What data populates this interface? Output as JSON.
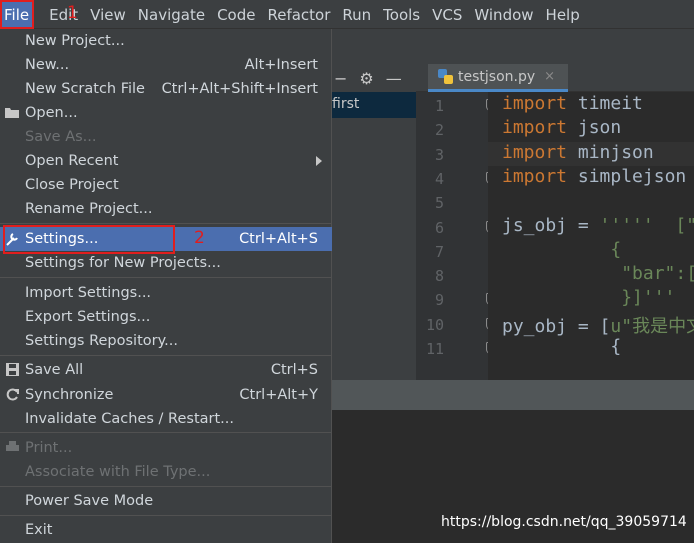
{
  "menubar": {
    "items": [
      "File",
      "Edit",
      "View",
      "Navigate",
      "Code",
      "Refactor",
      "Run",
      "Tools",
      "VCS",
      "Window",
      "Help"
    ]
  },
  "annotations": {
    "step1": "1",
    "step2": "2"
  },
  "file_menu": {
    "new_project": "New Project...",
    "new": "New...",
    "new_shortcut": "Alt+Insert",
    "new_scratch": "New Scratch File",
    "new_scratch_shortcut": "Ctrl+Alt+Shift+Insert",
    "open": "Open...",
    "save_as": "Save As...",
    "open_recent": "Open Recent",
    "close_project": "Close Project",
    "rename_project": "Rename Project...",
    "settings": "Settings...",
    "settings_shortcut": "Ctrl+Alt+S",
    "settings_new_projects": "Settings for New Projects...",
    "import_settings": "Import Settings...",
    "export_settings": "Export Settings...",
    "settings_repository": "Settings Repository...",
    "save_all": "Save All",
    "save_all_shortcut": "Ctrl+S",
    "synchronize": "Synchronize",
    "synchronize_shortcut": "Ctrl+Alt+Y",
    "invalidate_caches": "Invalidate Caches / Restart...",
    "print": "Print...",
    "associate": "Associate with File Type...",
    "power_save": "Power Save Mode",
    "exit": "Exit"
  },
  "project_panel": {
    "selected_item": "first"
  },
  "editor": {
    "tab_name": "testjson.py",
    "tab_close": "×",
    "line_numbers": [
      "1",
      "2",
      "3",
      "4",
      "5",
      "6",
      "7",
      "8",
      "9",
      "10",
      "11"
    ],
    "lines": [
      [
        {
          "t": "import",
          "c": "kw"
        },
        {
          "t": " timeit",
          "c": "id"
        }
      ],
      [
        {
          "t": "import",
          "c": "kw"
        },
        {
          "t": " json",
          "c": "id"
        }
      ],
      [
        {
          "t": "import",
          "c": "kw"
        },
        {
          "t": " minjson",
          "c": "id"
        }
      ],
      [
        {
          "t": "import",
          "c": "kw"
        },
        {
          "t": " simplejson",
          "c": "id"
        }
      ],
      [],
      [
        {
          "t": "js_obj",
          "c": "id"
        },
        {
          "t": " = ",
          "c": "id"
        },
        {
          "t": "'''''  [\"",
          "c": "str"
        }
      ],
      [
        {
          "t": "          {",
          "c": "str"
        }
      ],
      [
        {
          "t": "           \"bar\":[\"",
          "c": "str"
        }
      ],
      [
        {
          "t": "           }]'''",
          "c": "str"
        }
      ],
      [
        {
          "t": "py_obj",
          "c": "id"
        },
        {
          "t": " = [",
          "c": "id"
        },
        {
          "t": "u\"我是中文",
          "c": "str"
        }
      ],
      [
        {
          "t": "          {",
          "c": "id"
        }
      ]
    ]
  },
  "watermark": "https://blog.csdn.net/qq_39059714",
  "colors": {
    "selection": "#4b6eaf",
    "annotation": "#e01e1e",
    "keyword": "#cc7832",
    "string": "#6a8759"
  }
}
